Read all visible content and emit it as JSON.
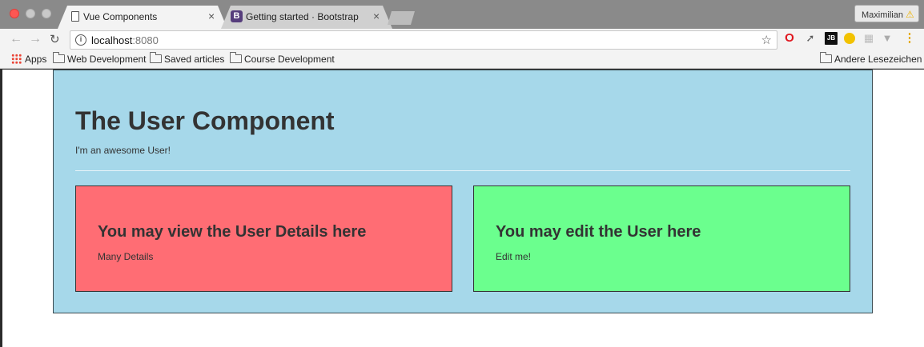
{
  "browser": {
    "tabs": [
      {
        "title": "Vue Components",
        "close": "×"
      },
      {
        "title": "Getting started · Bootstrap",
        "close": "×",
        "favicon_letter": "B"
      }
    ],
    "profile_name": "Maximilian",
    "profile_warning": "⚠",
    "address": {
      "host": "localhost",
      "port": ":8080"
    },
    "bookmarks": [
      {
        "label": "Apps"
      },
      {
        "label": "Web Development"
      },
      {
        "label": "Saved articles"
      },
      {
        "label": "Course Development"
      }
    ],
    "other_bookmarks": "Andere Lesezeichen",
    "extension_jb": "JB",
    "icons": {
      "back": "back-arrow-icon",
      "forward": "forward-arrow-icon",
      "reload": "reload-icon",
      "info": "info-icon",
      "star": "star-icon",
      "opera": "opera-icon",
      "pipette": "color-picker-icon",
      "vue": "vue-devtools-icon",
      "menu": "kebab-menu-icon"
    },
    "colors": {
      "close_button": "#fc5753",
      "accent_warning": "#f0b400"
    }
  },
  "page": {
    "title": "The User Component",
    "subtitle": "I'm an awesome User!",
    "detail_card": {
      "title": "You may view the User Details here",
      "text": "Many Details",
      "color": "#ff6d74"
    },
    "edit_card": {
      "title": "You may edit the User here",
      "text": "Edit me!",
      "color": "#6bff8e"
    },
    "container_color": "#a6d8ea"
  }
}
